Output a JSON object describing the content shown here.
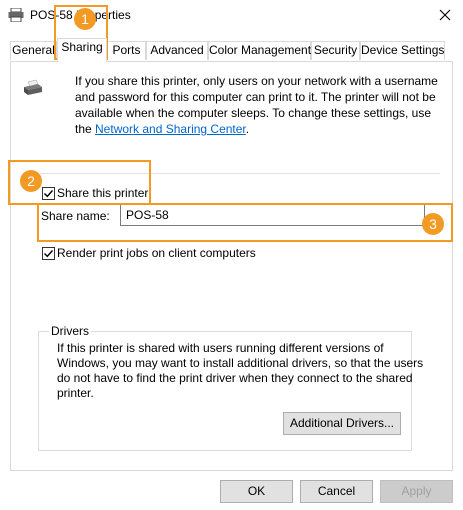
{
  "window": {
    "title": "POS-58 Properties"
  },
  "tabs": [
    {
      "label": "General"
    },
    {
      "label": "Sharing"
    },
    {
      "label": "Ports"
    },
    {
      "label": "Advanced"
    },
    {
      "label": "Color Management"
    },
    {
      "label": "Security"
    },
    {
      "label": "Device Settings"
    }
  ],
  "info": {
    "text": "If you share this printer, only users on your network with a username and password for this computer can print to it. The printer will not be available when the computer sleeps. To change these settings, use the ",
    "link": "Network and Sharing Center",
    "suffix": "."
  },
  "share": {
    "checkbox_label": "Share this printer",
    "checked": true,
    "name_label": "Share name:",
    "name_value": "POS-58"
  },
  "render": {
    "checkbox_label": "Render print jobs on client computers",
    "checked": true
  },
  "drivers": {
    "title": "Drivers",
    "text": "If this printer is shared with users running different versions of Windows, you may want to install additional drivers, so that the users do not have to find the print driver when they connect to the shared printer.",
    "button": "Additional Drivers..."
  },
  "footer": {
    "ok": "OK",
    "cancel": "Cancel",
    "apply": "Apply"
  },
  "callouts": [
    "1",
    "2",
    "3"
  ],
  "colors": {
    "accent": "#f39a24",
    "link": "#0066cc"
  },
  "icons": {
    "title": "printer-icon",
    "close": "close-icon",
    "check": "check-icon"
  }
}
